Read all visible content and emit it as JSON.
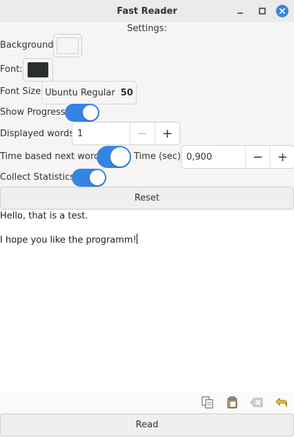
{
  "window": {
    "title": "Fast Reader"
  },
  "settings": {
    "heading": "Settings:",
    "background_label": "Background:",
    "background_color": "#f6f5f4",
    "font_label": "Font:",
    "font_color": "#2a2f2f",
    "font_size_label": "Font Size:",
    "font_name": "Ubuntu Regular",
    "font_size": "50",
    "show_progress_label": "Show Progress:",
    "show_progress": true,
    "displayed_words_label": "Displayed words:",
    "displayed_words": "1",
    "time_based_label": "Time based next word:",
    "time_based": true,
    "time_sec_label": "Time (sec):",
    "time_sec": "0,900",
    "collect_stats_label": "Collect Statistics:",
    "collect_stats": true,
    "reset_label": "Reset",
    "minus": "−",
    "plus": "+"
  },
  "editor": {
    "lines": [
      "Hello, that is a test.",
      "I hope you like the programm!"
    ]
  },
  "toolbar": {
    "icons": [
      "copy-icon",
      "paste-icon",
      "clear-icon",
      "undo-icon"
    ]
  },
  "read_label": "Read",
  "colors": {
    "accent": "#3584e4"
  }
}
